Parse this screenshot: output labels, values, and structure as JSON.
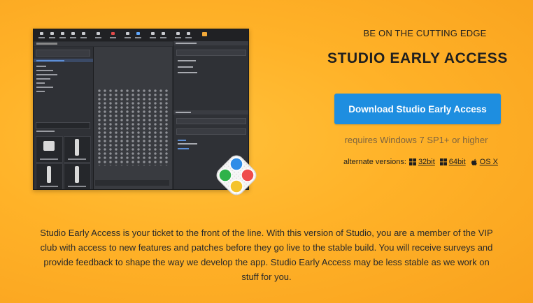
{
  "hero": {
    "tagline": "BE ON THE CUTTING EDGE",
    "title": "STUDIO EARLY ACCESS",
    "download_label": "Download Studio Early Access",
    "requirements": "requires Windows 7 SP1+ or higher"
  },
  "alternate": {
    "label": "alternate versions:",
    "versions": [
      {
        "label": "32bit",
        "icon": "windows-icon"
      },
      {
        "label": "64bit",
        "icon": "windows-icon"
      },
      {
        "label": "OS X",
        "icon": "apple-icon"
      }
    ]
  },
  "description": "Studio Early Access is your ticket to the front of the line. With this version of Studio, you are a member of the VIP club with access to new features and patches before they go live to the stable build. You will receive surveys and provide feedback to shape the way we develop the app. Studio Early Access may be less stable as we work on stuff for you.",
  "colors": {
    "background": "#ffb228",
    "button": "#1e8ee0",
    "button_text": "#ffffff",
    "muted_text": "#7d6440"
  },
  "app_icon": {
    "name": "studio-app-icon",
    "dot_colors": [
      "#2e8de8",
      "#ef4b4b",
      "#2fb24a",
      "#f4c32c"
    ]
  }
}
